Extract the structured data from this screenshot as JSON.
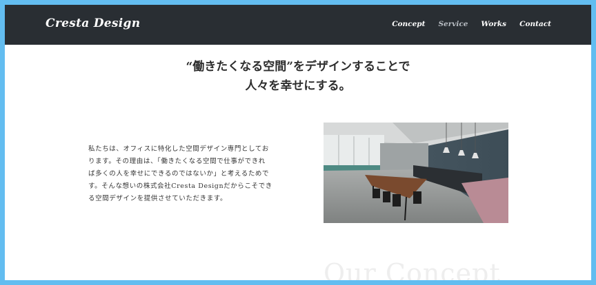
{
  "header": {
    "logo": "Cresta Design",
    "nav": [
      "Concept",
      "Service",
      "Works",
      "Contact"
    ]
  },
  "hero": {
    "line1": "“働きたくなる空間”をデザインすることで",
    "line2": "人々を幸せにする。"
  },
  "about": {
    "lines": [
      "私たちは、オフィスに特化した空間デザイン専門としてお",
      "ります。その理由は、「働きたくなる空間で仕事ができれ",
      "ば多くの人を幸せにできるのではないか」と考えるためで",
      "す。そんな想いの株式会社Cresta Designだからこそでき",
      "る空間デザインを提供させていただきます。"
    ]
  },
  "section_ghost_title": "Our Concept",
  "colors": {
    "outer_border": "#63bdf0",
    "header_bg": "#292e33",
    "nav_active": "#ffffff",
    "nav_dim": "#b9bec4"
  }
}
